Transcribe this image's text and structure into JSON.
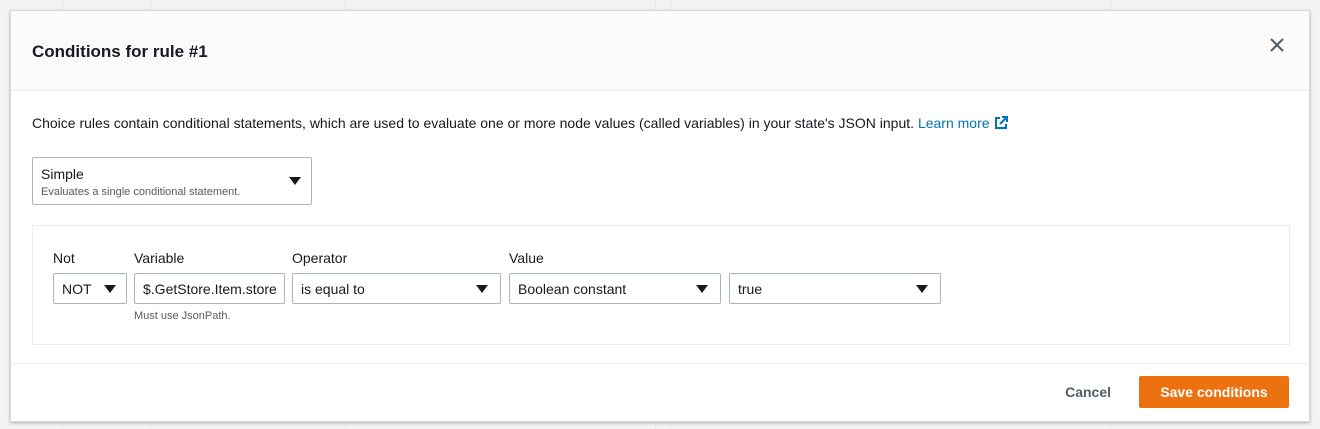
{
  "modal": {
    "title": "Conditions for rule #1",
    "description": "Choice rules contain conditional statements, which are used to evaluate one or more node values (called variables) in your state's JSON input. ",
    "learn_more": "Learn more"
  },
  "mode_select": {
    "value": "Simple",
    "description": "Evaluates a single conditional statement."
  },
  "condition": {
    "not_label": "Not",
    "not_value": "NOT",
    "variable_label": "Variable",
    "variable_value": "$.GetStore.Item.store",
    "variable_hint": "Must use JsonPath.",
    "operator_label": "Operator",
    "operator_value": "is equal to",
    "value_label": "Value",
    "value_type": "Boolean constant",
    "value_value": "true"
  },
  "footer": {
    "cancel_label": "Cancel",
    "save_label": "Save conditions"
  },
  "colors": {
    "primary_button": "#ec7211",
    "link": "#0073bb"
  },
  "icons": {
    "close": "close-icon",
    "external_link": "external-link-icon",
    "dropdown": "caret-down-icon"
  }
}
